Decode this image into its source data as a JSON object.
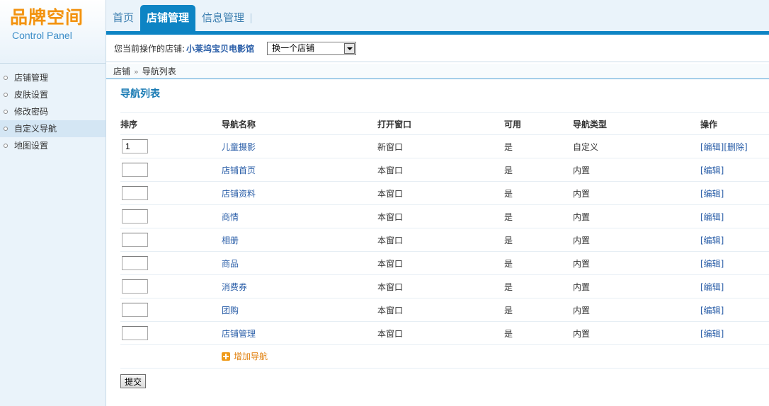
{
  "logo": {
    "title": "品牌空间",
    "subtitle": "Control Panel"
  },
  "tabs": [
    {
      "label": "首页",
      "active": false
    },
    {
      "label": "店铺管理",
      "active": true
    },
    {
      "label": "信息管理",
      "active": false
    }
  ],
  "sidebar": {
    "items": [
      {
        "label": "店铺管理",
        "active": false
      },
      {
        "label": "皮肤设置",
        "active": false
      },
      {
        "label": "修改密码",
        "active": false
      },
      {
        "label": "自定义导航",
        "active": true
      },
      {
        "label": "地图设置",
        "active": false
      }
    ]
  },
  "storebar": {
    "prefix": "您当前操作的店铺:",
    "store_name": "小莱坞宝贝电影馆",
    "select_value": "换一个店铺"
  },
  "breadcrumb": {
    "root": "店铺",
    "sep": "»",
    "current": "导航列表"
  },
  "page_title": "导航列表",
  "table": {
    "headers": [
      "排序",
      "导航名称",
      "打开窗口",
      "可用",
      "导航类型",
      "操作"
    ],
    "rows": [
      {
        "order": "1",
        "name": "儿童摄影",
        "window": "新窗口",
        "enabled": "是",
        "type": "自定义",
        "edit": "[编辑]",
        "delete": "[删除]"
      },
      {
        "order": "",
        "name": "店铺首页",
        "window": "本窗口",
        "enabled": "是",
        "type": "内置",
        "edit": "[编辑]"
      },
      {
        "order": "",
        "name": "店铺资料",
        "window": "本窗口",
        "enabled": "是",
        "type": "内置",
        "edit": "[编辑]"
      },
      {
        "order": "",
        "name": "商情",
        "window": "本窗口",
        "enabled": "是",
        "type": "内置",
        "edit": "[编辑]"
      },
      {
        "order": "",
        "name": "相册",
        "window": "本窗口",
        "enabled": "是",
        "type": "内置",
        "edit": "[编辑]"
      },
      {
        "order": "",
        "name": "商品",
        "window": "本窗口",
        "enabled": "是",
        "type": "内置",
        "edit": "[编辑]"
      },
      {
        "order": "",
        "name": "消费券",
        "window": "本窗口",
        "enabled": "是",
        "type": "内置",
        "edit": "[编辑]"
      },
      {
        "order": "",
        "name": "团购",
        "window": "本窗口",
        "enabled": "是",
        "type": "内置",
        "edit": "[编辑]"
      },
      {
        "order": "",
        "name": "店铺管理",
        "window": "本窗口",
        "enabled": "是",
        "type": "内置",
        "edit": "[编辑]"
      }
    ],
    "add_label": "增加导航"
  },
  "submit_label": "提交",
  "colors": {
    "accent": "#0d84c4",
    "link": "#2a5ea8",
    "logo": "#f2920f",
    "add": "#e07f0c"
  }
}
